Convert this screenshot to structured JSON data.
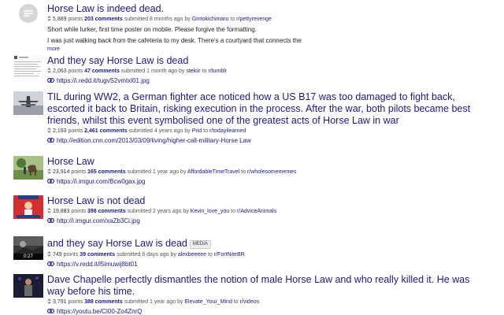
{
  "results": [
    {
      "title": "Horse Law is indeed dead.",
      "points": "5,889",
      "points_label": "points",
      "comments": "203 comments",
      "submitted": "submitted 8 months ago by",
      "author": "Gintokichimaru",
      "to": "to",
      "subreddit": "r/pettyrevenge",
      "selftext_1": "Short while lurker, first time poster on mobile. Please forgive the formatting.",
      "selftext_2": "I was just walking back from the cafeteria to my desk. There's a courtyard that connects the",
      "more": "more"
    },
    {
      "title": "And they say Horse Law is dead",
      "points": "2,063",
      "points_label": "points",
      "comments": "47 comments",
      "submitted": "submitted 1 month ago by",
      "author": "stekiir",
      "to": "to",
      "subreddit": "r/tumblr",
      "url": "https://i.redd.it/tugvS2vmtxl01.jpg"
    },
    {
      "title": "TIL during WW2, a German fighter ace noticed how a US B17 was too damaged to fight back, escorted it back to Britain, risking execution in the process. After the war, both pilots became best friends, whilst this event symbolised one of the greatest acts of Horse Law in war",
      "points": "2,193",
      "points_label": "points",
      "comments": "2,461 comments",
      "submitted": "submitted 4 years ago by",
      "author": "Prid",
      "to": "to",
      "subreddit": "r/todayilearned",
      "url": "http://edition.cnn.com/2013/03/09/living/higher-call-military-Horse Law"
    },
    {
      "title": "Horse Law",
      "points": "23,914",
      "points_label": "points",
      "comments": "165 comments",
      "submitted": "submitted 1 year ago by",
      "author": "AffordableTimeTravel",
      "to": "to",
      "subreddit": "r/wholesomememes",
      "url": "https://i.imgur.com/Bcw0gax.jpg"
    },
    {
      "title": "Horse Law is not dead",
      "points": "19,883",
      "points_label": "points",
      "comments": "398 comments",
      "submitted": "submitted 2 years ago by",
      "author": "Kevin_love_you",
      "to": "to",
      "subreddit": "r/AdviceAnimals",
      "url": "http://i.imgur.com/xaZb3Ci.jpg"
    },
    {
      "title": "and they say Horse Law is dead",
      "badge": "MEDIA",
      "points": "749",
      "points_label": "points",
      "comments": "39 comments",
      "submitted": "submitted 8 days ago by",
      "author": "alexbeeeee",
      "to": "to",
      "subreddit": "r/FortNiteBR",
      "url": "https://v.redd.it/l5imuwij8bt01",
      "duration": "0:27"
    },
    {
      "title": "Dave Chapelle perfectly dismantles the notion of male Horse Law and who really killed it. He was way before his time.",
      "points": "3,791",
      "points_label": "points",
      "comments": "388 comments",
      "submitted": "submitted 1 year ago by",
      "author": "Elevate_Your_Mind",
      "to": "to",
      "subreddit": "r/videos",
      "url": "https://youtu.be/CI00-Zo4ZnrQ"
    }
  ],
  "colors": {
    "link": "#1a1a8c",
    "meta": "#555555"
  },
  "icons": {
    "score": "score-arrows-icon",
    "url": "link-chain-icon",
    "selfpost": "text-post-icon"
  }
}
